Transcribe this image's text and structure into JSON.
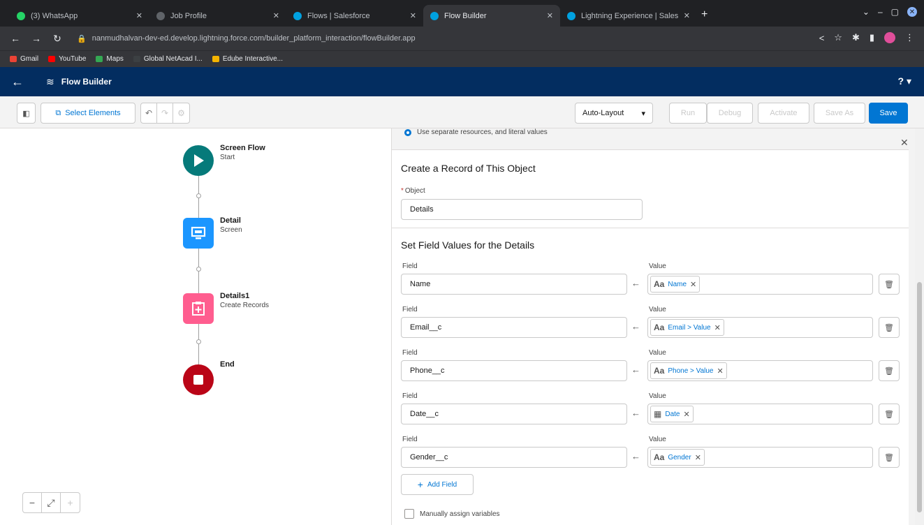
{
  "browser": {
    "tabs": [
      {
        "label": "(3) WhatsApp",
        "color": "#25d366"
      },
      {
        "label": "Job Profile",
        "color": "#5f6368"
      },
      {
        "label": "Flows | Salesforce",
        "color": "#00a1e0"
      },
      {
        "label": "Flow Builder",
        "color": "#00a1e0"
      },
      {
        "label": "Lightning Experience | Sales",
        "color": "#00a1e0"
      }
    ],
    "new_tab_label": "+",
    "url": "nanmudhalvan-dev-ed.develop.lightning.force.com/builder_platform_interaction/flowBuilder.app",
    "bookmarks": [
      {
        "label": "Gmail",
        "color": "#ea4335"
      },
      {
        "label": "YouTube",
        "color": "#ff0000"
      },
      {
        "label": "Maps",
        "color": "#34a853"
      },
      {
        "label": "Global NetAcad I...",
        "color": "#3c4043"
      },
      {
        "label": "Edube Interactive...",
        "color": "#f4b400"
      }
    ]
  },
  "app": {
    "title": "Flow Builder",
    "help": "?"
  },
  "toolbar": {
    "select_elements": "Select Elements",
    "layout_mode": "Auto-Layout",
    "run": "Run",
    "debug": "Debug",
    "activate": "Activate",
    "save_as": "Save As",
    "save": "Save"
  },
  "canvas": {
    "nodes": [
      {
        "title": "Screen Flow",
        "subtitle": "Start",
        "color": "#067a7a"
      },
      {
        "title": "Detail",
        "subtitle": "Screen",
        "color": "#1b96ff"
      },
      {
        "title": "Details1",
        "subtitle": "Create Records",
        "color": "#ff5d8f"
      },
      {
        "title": "End",
        "subtitle": "",
        "color": "#ba0517"
      }
    ]
  },
  "panel": {
    "radio_option": "Use separate resources, and literal values",
    "create_section_title": "Create a Record of This Object",
    "object_label": "Object",
    "object_value": "Details",
    "set_fields_title": "Set Field Values for the Details",
    "field_header": "Field",
    "value_header": "Value",
    "rows": [
      {
        "field": "Name",
        "value": "Name",
        "icon": "Aa"
      },
      {
        "field": "Email__c",
        "value": "Email > Value",
        "icon": "Aa"
      },
      {
        "field": "Phone__c",
        "value": "Phone > Value",
        "icon": "Aa"
      },
      {
        "field": "Date__c",
        "value": "Date",
        "icon": "cal"
      },
      {
        "field": "Gender__c",
        "value": "Gender",
        "icon": "Aa"
      }
    ],
    "add_field": "Add Field",
    "manual_assign": "Manually assign variables"
  }
}
